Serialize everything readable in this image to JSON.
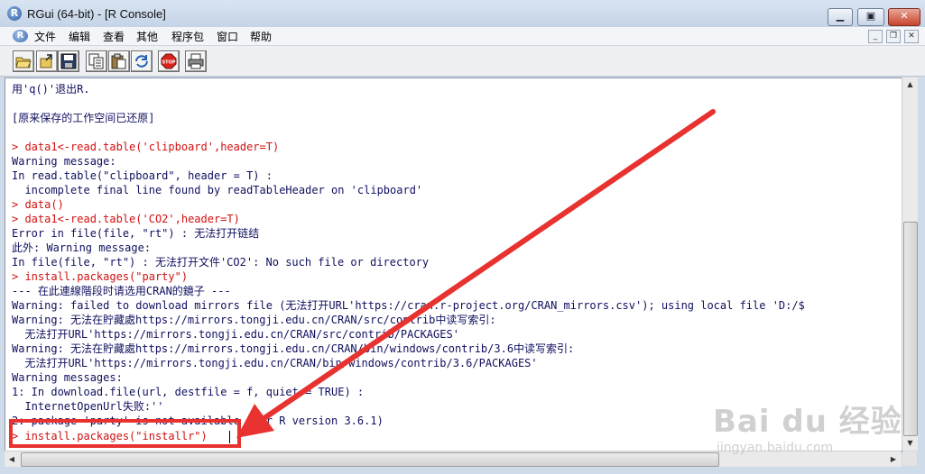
{
  "window": {
    "title": "RGui (64-bit) - [R Console]"
  },
  "menus": [
    "文件",
    "编辑",
    "查看",
    "其他",
    "程序包",
    "窗口",
    "帮助"
  ],
  "toolbar": {
    "buttons": [
      {
        "name": "open-script",
        "icon": "folder-open-icon"
      },
      {
        "name": "load-workspace",
        "icon": "load-icon"
      },
      {
        "name": "save-workspace",
        "icon": "save-icon"
      },
      {
        "name": "copy",
        "icon": "copy-icon"
      },
      {
        "name": "paste",
        "icon": "paste-icon"
      },
      {
        "name": "copy-paste",
        "icon": "refresh-icon"
      },
      {
        "name": "stop",
        "icon": "stop-icon",
        "label": "STOP"
      },
      {
        "name": "print",
        "icon": "print-icon"
      }
    ]
  },
  "console": {
    "lines": [
      {
        "text": "用'q()'退出R.",
        "color": "blue"
      },
      {
        "text": "",
        "color": "blue"
      },
      {
        "text": "[原来保存的工作空间已还原]",
        "color": "blue"
      },
      {
        "text": "",
        "color": "blue"
      },
      {
        "text": "> data1<-read.table('clipboard',header=T)",
        "color": "red"
      },
      {
        "text": "Warning message:",
        "color": "blue"
      },
      {
        "text": "In read.table(\"clipboard\", header = T) :",
        "color": "blue"
      },
      {
        "text": "  incomplete final line found by readTableHeader on 'clipboard'",
        "color": "blue"
      },
      {
        "text": "> data()",
        "color": "red"
      },
      {
        "text": "> data1<-read.table('CO2',header=T)",
        "color": "red"
      },
      {
        "text": "Error in file(file, \"rt\") : 无法打开链结",
        "color": "blue"
      },
      {
        "text": "此外: Warning message:",
        "color": "blue"
      },
      {
        "text": "In file(file, \"rt\") : 无法打开文件'CO2': No such file or directory",
        "color": "blue"
      },
      {
        "text": "> install.packages(\"party\")",
        "color": "red"
      },
      {
        "text": "--- 在此連線階段时请选用CRAN的鏡子 ---",
        "color": "blue"
      },
      {
        "text": "Warning: failed to download mirrors file (无法打开URL'https://cran.r-project.org/CRAN_mirrors.csv'); using local file 'D:/$",
        "color": "blue"
      },
      {
        "text": "Warning: 无法在貯藏處https://mirrors.tongji.edu.cn/CRAN/src/contrib中读写索引:",
        "color": "blue"
      },
      {
        "text": "  无法打开URL'https://mirrors.tongji.edu.cn/CRAN/src/contrib/PACKAGES'",
        "color": "blue"
      },
      {
        "text": "Warning: 无法在貯藏處https://mirrors.tongji.edu.cn/CRAN/bin/windows/contrib/3.6中读写索引:",
        "color": "blue"
      },
      {
        "text": "  无法打开URL'https://mirrors.tongji.edu.cn/CRAN/bin/windows/contrib/3.6/PACKAGES'",
        "color": "blue"
      },
      {
        "text": "Warning messages:",
        "color": "blue"
      },
      {
        "text": "1: In download.file(url, destfile = f, quiet = TRUE) :",
        "color": "blue"
      },
      {
        "text": "  InternetOpenUrl失败:''",
        "color": "blue"
      },
      {
        "text": "2: package 'party' is not available (for R version 3.6.1)",
        "color": "blue"
      },
      {
        "text": "> install.packages(\"installr\")",
        "color": "red"
      }
    ]
  },
  "watermark": {
    "brand": "Bai du 经验",
    "url": "jingyan.baidu.com"
  },
  "colors": {
    "prompt": "#d01010",
    "output": "#101060",
    "annotation": "#e8322f"
  }
}
